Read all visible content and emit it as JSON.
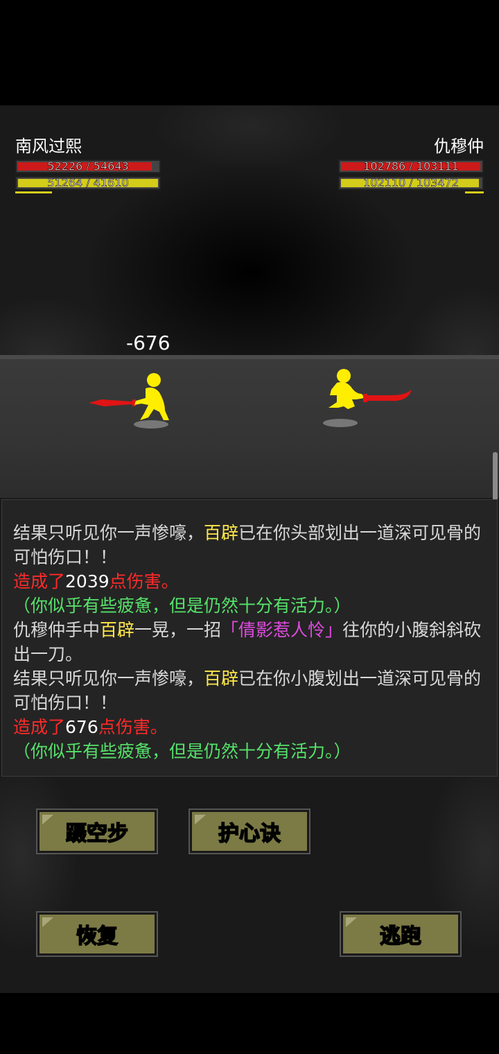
{
  "player": {
    "name": "南风过熙",
    "hp_text": "52226 / 54643",
    "hp_fraction": 0.955,
    "mp_text": "51264 / 41610",
    "mp_fraction": 1.0,
    "extra_fraction": 0.25
  },
  "enemy": {
    "name": "仇穆仲",
    "hp_text": "102786 / 103111",
    "hp_fraction": 0.997,
    "mp_text": "102110 / 103472",
    "mp_fraction": 0.987,
    "extra_fraction": 0.13
  },
  "damage_popup": "-676",
  "log": [
    [
      {
        "t": "结果只听见你一声惨嚎，",
        "c": "grey"
      },
      {
        "t": "百辟",
        "c": "yellow"
      },
      {
        "t": "已在你头部划出一道深可见骨的可怕伤口！！",
        "c": "grey"
      }
    ],
    [
      {
        "t": "造成了",
        "c": "red"
      },
      {
        "t": "2039",
        "c": "white"
      },
      {
        "t": "点伤害。",
        "c": "red"
      }
    ],
    [
      {
        "t": "（你似乎有些疲惫，但是仍然十分有活力。）",
        "c": "green"
      }
    ],
    [
      {
        "t": "仇穆仲手中",
        "c": "grey"
      },
      {
        "t": "百辟",
        "c": "yellow"
      },
      {
        "t": "一晃，一招",
        "c": "grey"
      },
      {
        "t": "「倩影惹人怜」",
        "c": "purple"
      },
      {
        "t": "往你的小腹斜斜砍出一刀。",
        "c": "grey"
      }
    ],
    [
      {
        "t": "结果只听见你一声惨嚎，",
        "c": "grey"
      },
      {
        "t": "百辟",
        "c": "yellow"
      },
      {
        "t": "已在你小腹划出一道深可见骨的可怕伤口！！",
        "c": "grey"
      }
    ],
    [
      {
        "t": "造成了",
        "c": "red"
      },
      {
        "t": "676",
        "c": "white"
      },
      {
        "t": "点伤害。",
        "c": "red"
      }
    ],
    [
      {
        "t": "（你似乎有些疲惫，但是仍然十分有活力。）",
        "c": "green"
      }
    ]
  ],
  "buttons": {
    "skill1": "蹑空步",
    "skill2": "护心诀",
    "recover": "恢复",
    "flee": "逃跑"
  },
  "colors": {
    "hp": "#cc1a1a",
    "mp": "#d4cc1a",
    "fighter": "#ffee00",
    "weapon": "#e01414",
    "button": "#7c7a45"
  }
}
